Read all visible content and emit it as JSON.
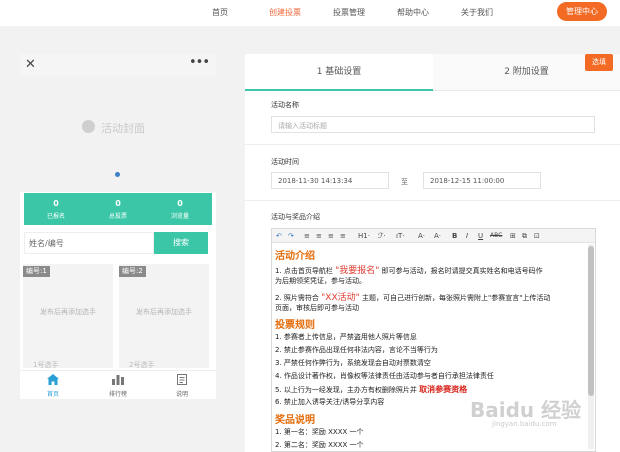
{
  "nav": {
    "items": [
      "首页",
      "创建投票",
      "投票管理",
      "帮助中心",
      "关于我们"
    ],
    "admin_button": "管理中心",
    "accent": "#ee6a3c"
  },
  "phone": {
    "close_icon": "close-icon",
    "more_icon": "more-dots-icon",
    "cover_text": "活动封面",
    "stats": [
      {
        "value": "0",
        "label": "已报名"
      },
      {
        "value": "0",
        "label": "总投票"
      },
      {
        "value": "0",
        "label": "浏览量"
      }
    ],
    "search_placeholder": "姓名/编号",
    "search_button": "搜索",
    "cards": [
      {
        "badge": "编号:1",
        "hint": "发布后再添加选手",
        "meta": "1号选手"
      },
      {
        "badge": "编号:2",
        "hint": "发布后再添加选手",
        "meta": "2号选手"
      }
    ],
    "tabs": [
      {
        "label": "首页",
        "icon": "home-icon"
      },
      {
        "label": "排行榜",
        "icon": "chart-icon"
      },
      {
        "label": "说明",
        "icon": "document-icon"
      }
    ],
    "theme_color": "#3bc7a7"
  },
  "form": {
    "tabs": [
      "1 基础设置",
      "2 附加设置"
    ],
    "options_button": "选填",
    "name_label": "活动名称",
    "name_placeholder": "请输入活动标题",
    "time_label": "活动时间",
    "start_time": "2018-11-30 14:13:34",
    "to_text": "至",
    "end_time": "2018-12-15 11:00:00",
    "intro_label": "活动与奖品介绍",
    "toolbar": [
      "↶",
      "↷",
      "≡",
      "≡",
      "≡",
      "≡",
      "H1·",
      "ℱ·",
      "ıT·",
      "A·",
      "A·",
      "B",
      "I",
      "U",
      "ABC",
      "⊞",
      "⧉",
      "⊡"
    ],
    "content": {
      "h1": "活动介绍",
      "p1_a": "1. 点击首页导航栏 ",
      "p1_red": "\"我要报名\"",
      "p1_b": " 即可参与活动，报名时请提交真实姓名和电话号码作",
      "p1_c": "为后期领奖凭证，参与活动。",
      "p2_a": "2. 照片需符合 ",
      "p2_red": "\"XX活动\"",
      "p2_b": " 主题，可自己进行创新，每张照片需附上\"参赛宣言\"上传活动",
      "p2_c": "页面，审核后即可参与活动",
      "h2": "投票规则",
      "r1": "1. 参赛者上传信息，严禁盗用他人照片等信息",
      "r2": "2. 禁止参赛作品出现任何非法内容，言论不当等行为",
      "r3": "3. 严禁任何作弊行为，系统发现会自动对票数清空",
      "r4": "4. 作品设计著作权，肖像权等法律责任由活动参与者自行承担法律责任",
      "r5_a": "5. 以上行为一经发现，主办方有权删除照片并 ",
      "r5_red": "取消参赛资格",
      "r6": "6. 禁止加入诱导关注/诱导分享内容",
      "h3": "奖品说明",
      "a1": "1. 第一名：奖励 XXXX 一个",
      "a2": "2. 第二名：奖励 XXXX 一个"
    }
  },
  "watermark": {
    "main": "Baidu 经验",
    "sub": "jingyan.baidu.com"
  }
}
